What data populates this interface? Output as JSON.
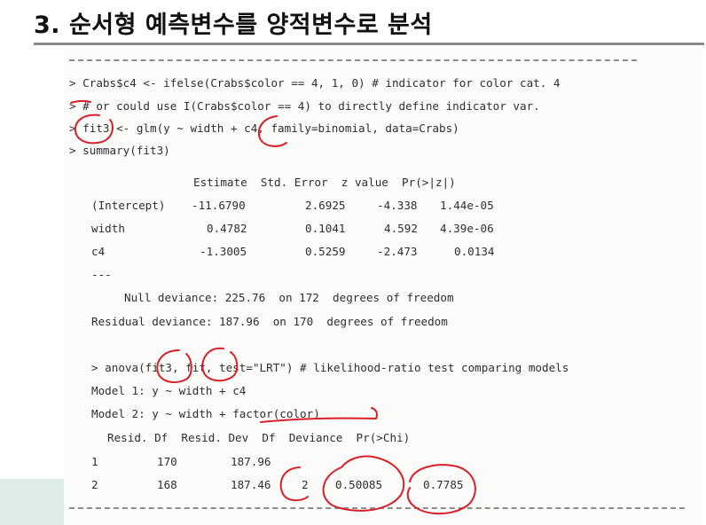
{
  "slide": {
    "title": "3. 순서형 예측변수를 양적변수로  분석"
  },
  "code": {
    "cmd1": "> Crabs$c4 <- ifelse(Crabs$color == 4, 1, 0) # indicator for color cat. 4",
    "cmd2": "> # or could use I(Crabs$color == 4) to directly define indicator var.",
    "cmd3": "> fit3 <- glm(y ~ width + c4, family=binomial, data=Crabs)",
    "cmd4": "> summary(fit3)",
    "coef_header": "Estimate  Std. Error  z value  Pr(>|z|)",
    "coef_rows": [
      {
        "name": "(Intercept)",
        "estimate": "-11.6790",
        "se": "2.6925",
        "z": "-4.338",
        "p": "1.44e-05"
      },
      {
        "name": "width",
        "estimate": "0.4782",
        "se": "0.1041",
        "z": "4.592",
        "p": "4.39e-06"
      },
      {
        "name": "c4",
        "estimate": "-1.3005",
        "se": "0.5259",
        "z": "-2.473",
        "p": "0.0134"
      }
    ],
    "sep": "---",
    "null_dev": "Null deviance: 225.76  on 172  degrees of freedom",
    "resid_dev": "Residual deviance: 187.96  on 170  degrees of freedom",
    "cmd5": "> anova(fit3, fit, test=\"LRT\") # likelihood-ratio test comparing models",
    "model1": "Model 1: y ~ width + c4",
    "model2": "Model 2: y ~ width + factor(color)",
    "anova_header": "Resid. Df  Resid. Dev  Df  Deviance  Pr(>Chi)",
    "anova_rows": [
      {
        "idx": "1",
        "df": "170",
        "dev": "187.96",
        "d": "",
        "deviance": "",
        "p": ""
      },
      {
        "idx": "2",
        "df": "168",
        "dev": "187.46",
        "d": "2",
        "deviance": "0.50085",
        "p": "0.7785"
      }
    ]
  },
  "colors": {
    "annotation_ink": "#d8202a",
    "code_text": "#2f2f2f",
    "panel_bg": "#fbfbfa",
    "accent": "#dfece8"
  }
}
